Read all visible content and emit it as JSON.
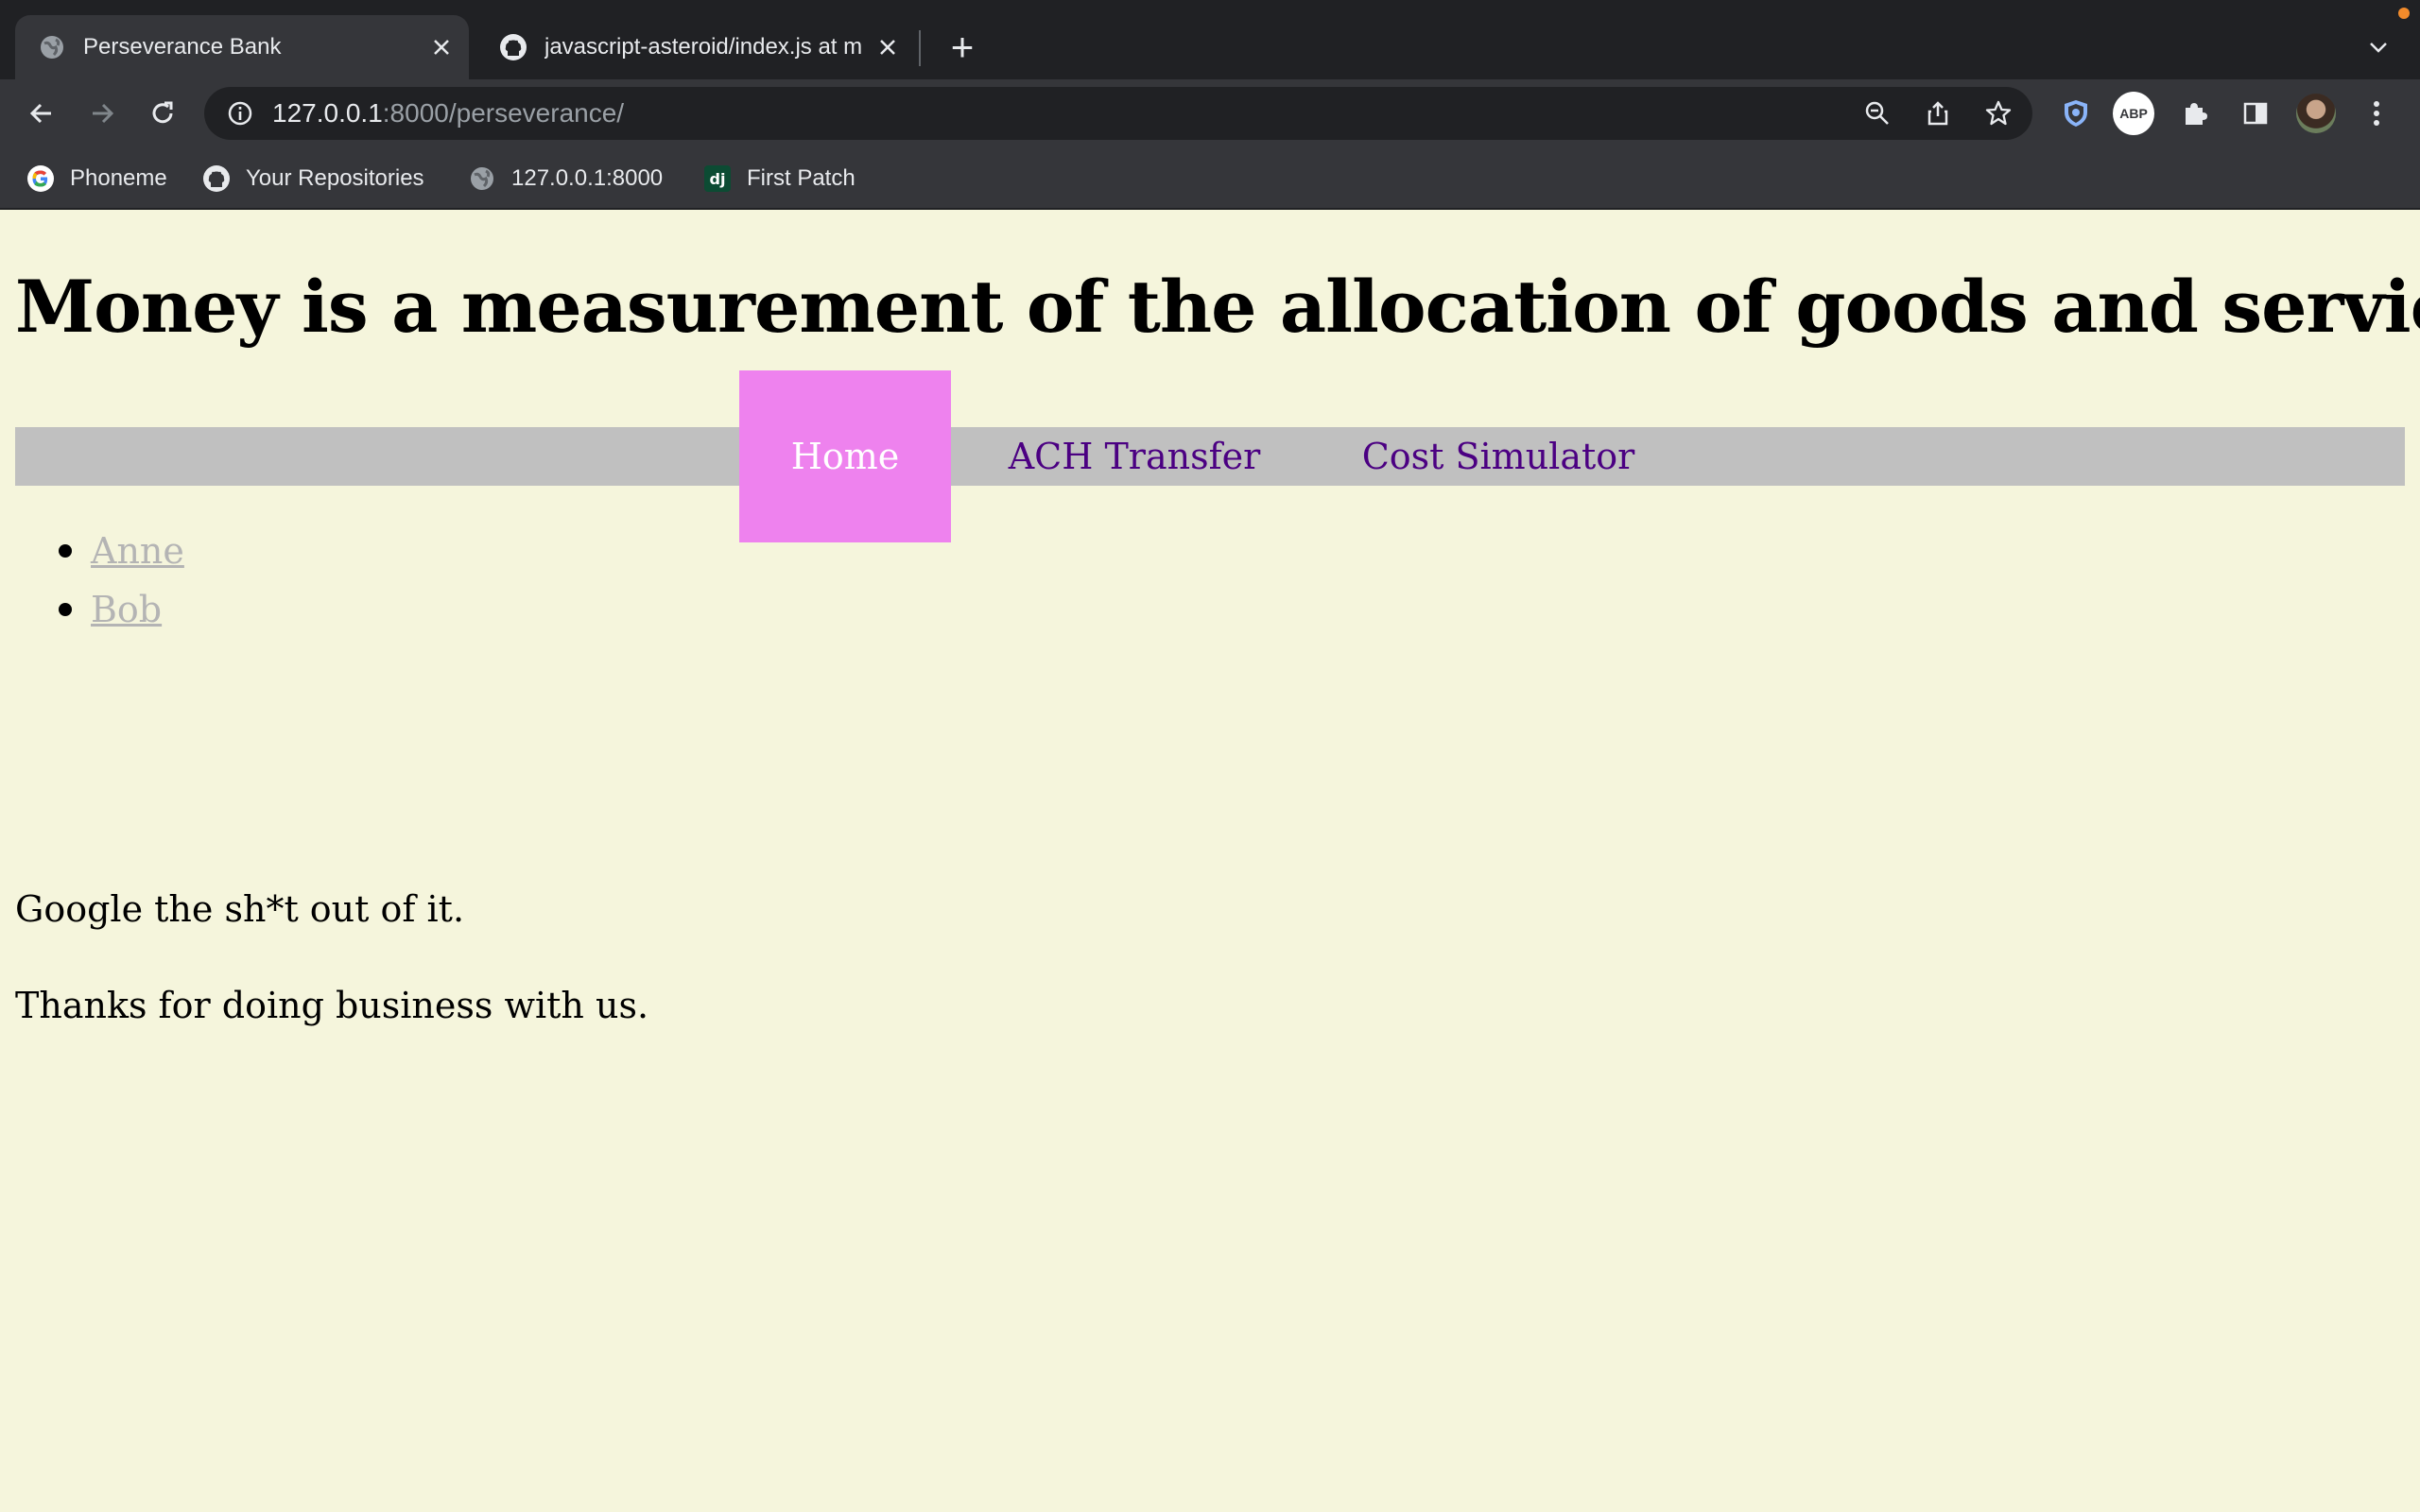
{
  "browser": {
    "tabs": [
      {
        "title": "Perseverance Bank",
        "icon": "globe-icon",
        "active": true
      },
      {
        "title": "javascript-asteroid/index.js at m",
        "icon": "github-icon",
        "active": false
      }
    ],
    "address_bar": {
      "host": "127.0.0.1",
      "path": ":8000/perseverance/"
    },
    "bookmarks": [
      {
        "label": "Phoneme",
        "icon": "google-icon"
      },
      {
        "label": "Your Repositories",
        "icon": "github-icon"
      },
      {
        "label": "127.0.0.1:8000",
        "icon": "globe-icon"
      },
      {
        "label": "First Patch",
        "icon": "django-icon"
      }
    ],
    "extensions": {
      "abp_label": "ABP"
    },
    "colors": {
      "tabstrip": "#202124",
      "toolbar": "#35363a",
      "recording_dot": "#f28b2b"
    }
  },
  "page": {
    "headline": "Money is a measurement of the allocation of goods and service",
    "nav": [
      {
        "label": "Home",
        "active": true
      },
      {
        "label": "ACH Transfer",
        "active": false
      },
      {
        "label": "Cost Simulator",
        "active": false
      }
    ],
    "users": [
      "Anne",
      "Bob"
    ],
    "paragraphs": [
      "Google the sh*t out of it.",
      "Thanks for doing business with us."
    ],
    "colors": {
      "background": "#f5f5dc",
      "navbar": "#c0c0c0",
      "nav_active_bg": "#ee82ee",
      "nav_link": "#4b0082",
      "user_link": "#b4b4b4"
    }
  }
}
